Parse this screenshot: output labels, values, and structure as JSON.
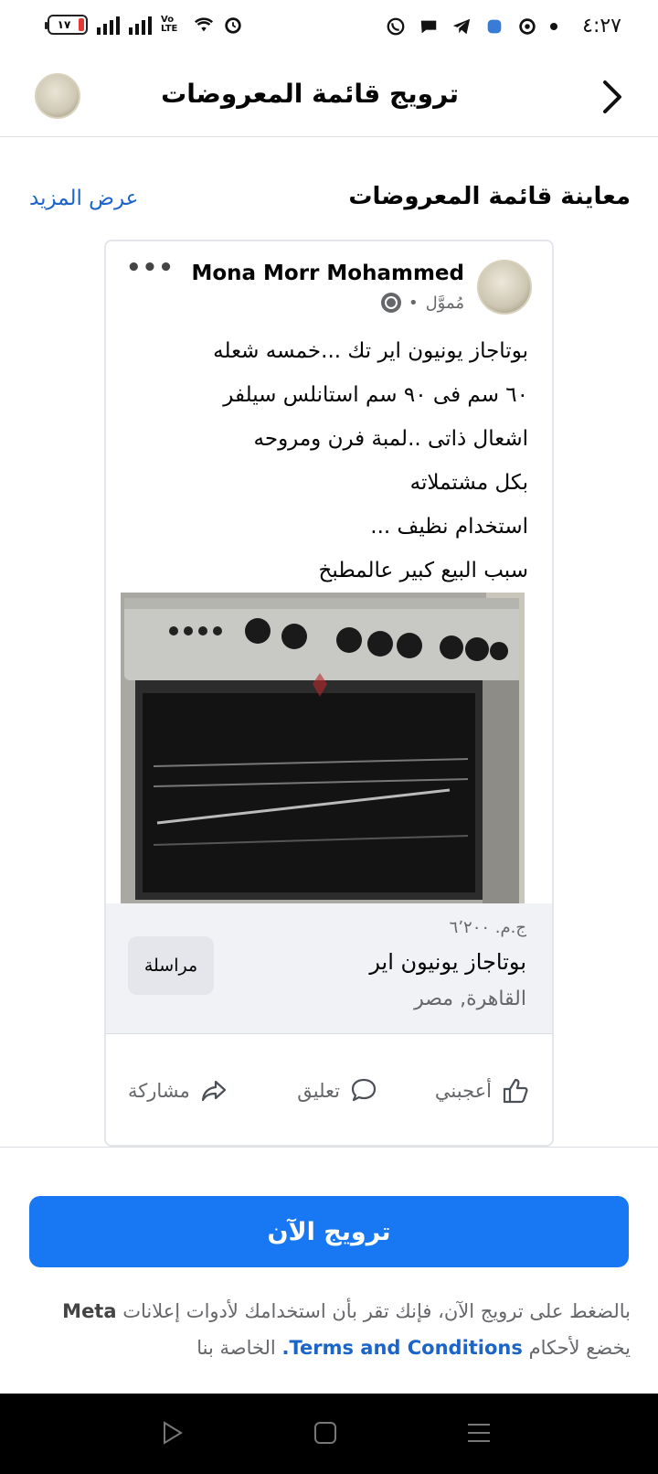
{
  "status_bar": {
    "time": "٤:٢٧",
    "battery": "١٧",
    "network": "Vo LTE"
  },
  "header": {
    "title": "ترويج قائمة المعروضات"
  },
  "preview": {
    "section_title": "معاينة قائمة المعروضات",
    "see_more": "عرض المزيد"
  },
  "post": {
    "author": "Mona Morr Mohammed",
    "sponsored": "مُموَّل",
    "text_lines": [
      "بوتاجاز يونيون اير تك ...خمسه شعله",
      "٦٠ سم فى ٩٠ سم استانلس سيلفر",
      "اشعال ذاتى ..لمبة فرن ومروحه",
      "بكل مشتملاته",
      "استخدام نظيف ...",
      "سبب البيع كبير عالمطبخ"
    ],
    "listing": {
      "price": "ج.م. ٦٬٢٠٠",
      "title": "بوتاجاز يونيون اير",
      "location": "القاهرة, مصر",
      "message_label": "مراسلة"
    },
    "actions": {
      "like": "أعجبني",
      "comment": "تعليق",
      "share": "مشاركة"
    }
  },
  "boost": {
    "button_label": "ترويج الآن",
    "disclaimer_part1": "بالضغط على ترويج الآن، فإنك تقر بأن استخدامك لأدوات إعلانات",
    "meta": "Meta",
    "disclaimer_part2": "يخضع لأحكام",
    "terms": "Terms and Conditions.",
    "disclaimer_part3": "الخاصة بنا"
  },
  "colors": {
    "accent": "#1877f2",
    "link": "#1b64c8"
  }
}
